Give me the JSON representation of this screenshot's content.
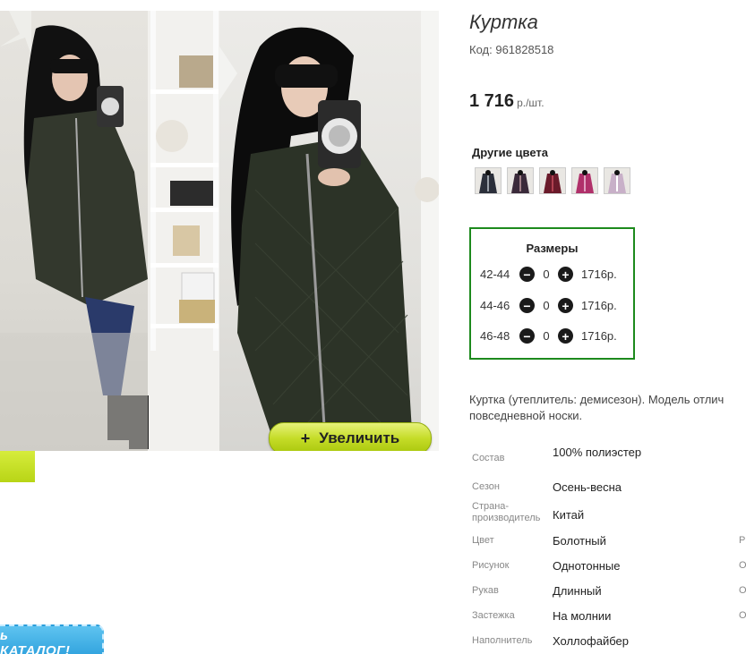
{
  "product": {
    "title": "Куртка",
    "code_label": "Код:",
    "code_value": "961828518",
    "price_value": "1 716",
    "price_unit": "р./шт."
  },
  "gallery": {
    "zoom_label": "Увеличить",
    "zoom_icon": "plus-icon",
    "catalog_label": "ь КАТАЛОГ!"
  },
  "colors": {
    "title": "Другие цвета",
    "swatches": [
      {
        "color": "#2b2f3a",
        "accent": "#9aa0a8"
      },
      {
        "color": "#3a2a3a",
        "accent": "#a08088"
      },
      {
        "color": "#6a1a2a",
        "accent": "#b04050"
      },
      {
        "color": "#b0306a",
        "accent": "#e0a0c0"
      },
      {
        "color": "#c8b0c8",
        "accent": "#ffffff"
      }
    ]
  },
  "sizes": {
    "title": "Размеры",
    "rows": [
      {
        "label": "42-44",
        "qty": "0",
        "price": "1716р."
      },
      {
        "label": "44-46",
        "qty": "0",
        "price": "1716р."
      },
      {
        "label": "46-48",
        "qty": "0",
        "price": "1716р."
      }
    ],
    "minus_icon": "minus-circle-icon",
    "plus_icon": "plus-circle-icon"
  },
  "description": {
    "line1": "Куртка (утеплитель: демисезон). Модель отлич",
    "line2": "повседневной носки."
  },
  "specs": [
    {
      "label": "Состав",
      "value": "100% полиэстер",
      "extra": ""
    },
    {
      "label": "Сезон",
      "value": "Осень-весна",
      "extra": ""
    },
    {
      "label": "Страна-производитель",
      "value": "Китай",
      "extra": ""
    },
    {
      "label": "Цвет",
      "value": "Болотный",
      "extra": "Р"
    },
    {
      "label": "Рисунок",
      "value": "Однотонные",
      "extra": "О"
    },
    {
      "label": "Рукав",
      "value": "Длинный",
      "extra": "О"
    },
    {
      "label": "Застежка",
      "value": "На молнии",
      "extra": "О"
    },
    {
      "label": "Наполнитель",
      "value": "Холлофайбер",
      "extra": ""
    }
  ],
  "colors_brand": {
    "sizes_border": "#1d8a1d",
    "zoom_button": "#c5dc28",
    "catalog_button": "#2a9edb"
  }
}
